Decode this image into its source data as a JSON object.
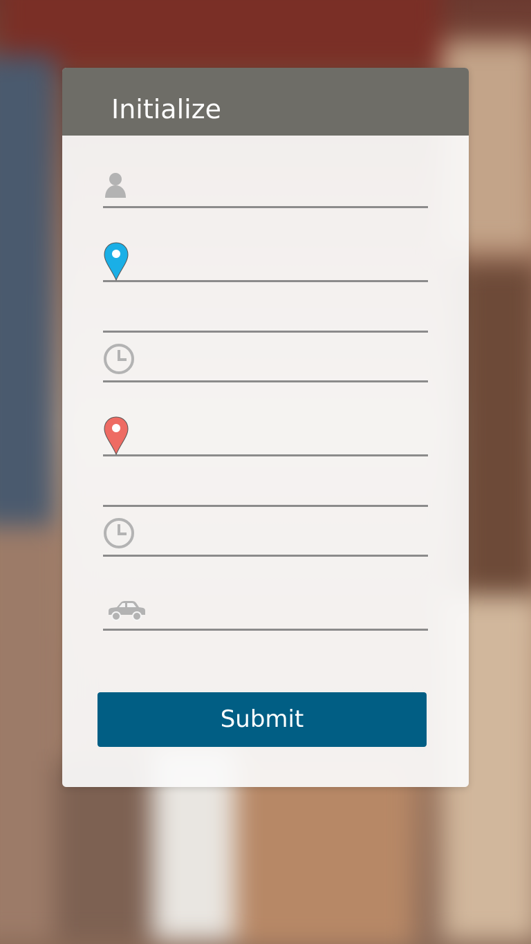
{
  "form": {
    "title": "Initialize",
    "fields": [
      {
        "icon": "user-icon",
        "value": "",
        "placeholder": ""
      },
      {
        "icon": "location-pin-blue-icon",
        "value": "",
        "placeholder": ""
      },
      {
        "icon": "",
        "value": "",
        "placeholder": ""
      },
      {
        "icon": "clock-icon",
        "value": "",
        "placeholder": ""
      },
      {
        "icon": "location-pin-red-icon",
        "value": "",
        "placeholder": ""
      },
      {
        "icon": "",
        "value": "",
        "placeholder": ""
      },
      {
        "icon": "clock-icon",
        "value": "",
        "placeholder": ""
      },
      {
        "icon": "car-icon",
        "value": "",
        "placeholder": ""
      }
    ],
    "submit_label": "Submit"
  },
  "colors": {
    "header": "#6e6d67",
    "submit": "#015e84",
    "pin_blue": "#1aafe6",
    "pin_red": "#ee6b63",
    "icon_gray": "#b3b3b3",
    "underline": "#8b8b8b"
  }
}
